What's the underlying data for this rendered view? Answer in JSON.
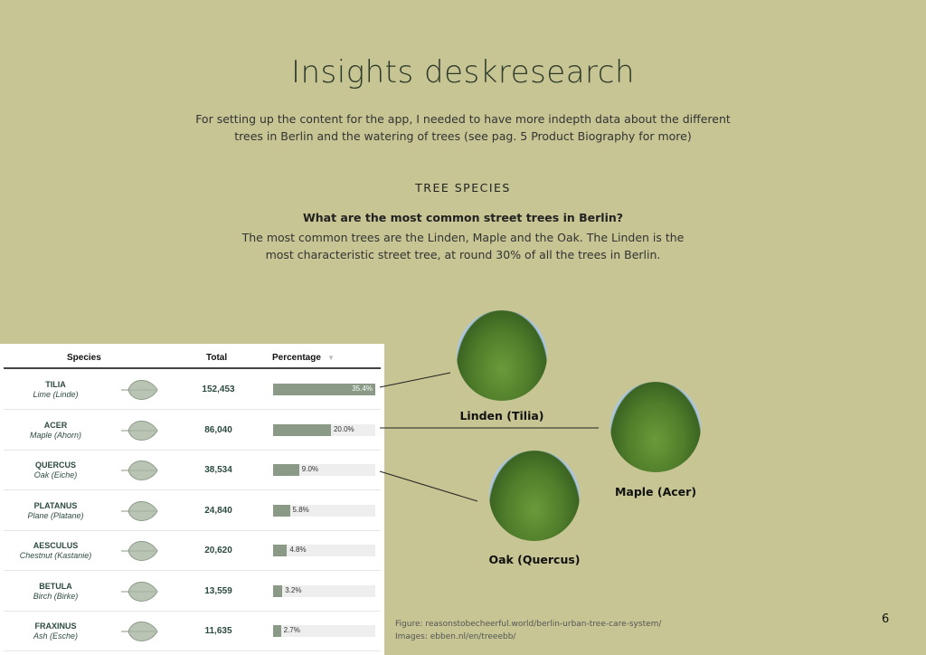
{
  "title": "Insights deskresearch",
  "intro": "For setting up the content for the app, I needed to have more indepth data about the different trees in Berlin and the watering of trees (see pag. 5 Product Biography for more)",
  "section": "TREE SPECIES",
  "question": "What are the most common street trees in Berlin?",
  "answer": "The most common trees are the Linden, Maple and the Oak. The Linden is the most characteristic street tree, at round 30% of all the trees in Berlin.",
  "table": {
    "headers": {
      "species": "Species",
      "total": "Total",
      "percentage": "Percentage",
      "sort_icon": "▼"
    },
    "rows": [
      {
        "genus": "TILIA",
        "common": "Lime (Linde)",
        "total": "152,453",
        "percent": 35.4,
        "label": "35.4%"
      },
      {
        "genus": "ACER",
        "common": "Maple (Ahorn)",
        "total": "86,040",
        "percent": 20.0,
        "label": "20.0%"
      },
      {
        "genus": "QUERCUS",
        "common": "Oak (Eiche)",
        "total": "38,534",
        "percent": 9.0,
        "label": "9.0%"
      },
      {
        "genus": "PLATANUS",
        "common": "Plane (Platane)",
        "total": "24,840",
        "percent": 5.8,
        "label": "5.8%"
      },
      {
        "genus": "AESCULUS",
        "common": "Chestnut (Kastanie)",
        "total": "20,620",
        "percent": 4.8,
        "label": "4.8%"
      },
      {
        "genus": "BETULA",
        "common": "Birch (Birke)",
        "total": "13,559",
        "percent": 3.2,
        "label": "3.2%"
      },
      {
        "genus": "FRAXINUS",
        "common": "Ash (Esche)",
        "total": "11,635",
        "percent": 2.7,
        "label": "2.7%"
      }
    ]
  },
  "photos": {
    "linden": "Linden (Tilia)",
    "maple": "Maple (Acer)",
    "oak": "Oak (Quercus)"
  },
  "footer": {
    "figure": "Figure: reasonstobecheerful.world/berlin-urban-tree-care-system/",
    "images": "Images: ebben.nl/en/treeebb/"
  },
  "page_number": "6",
  "colors": {
    "background": "#c6c593",
    "bar": "#8a9a86",
    "text_green": "#2b4a3e"
  }
}
